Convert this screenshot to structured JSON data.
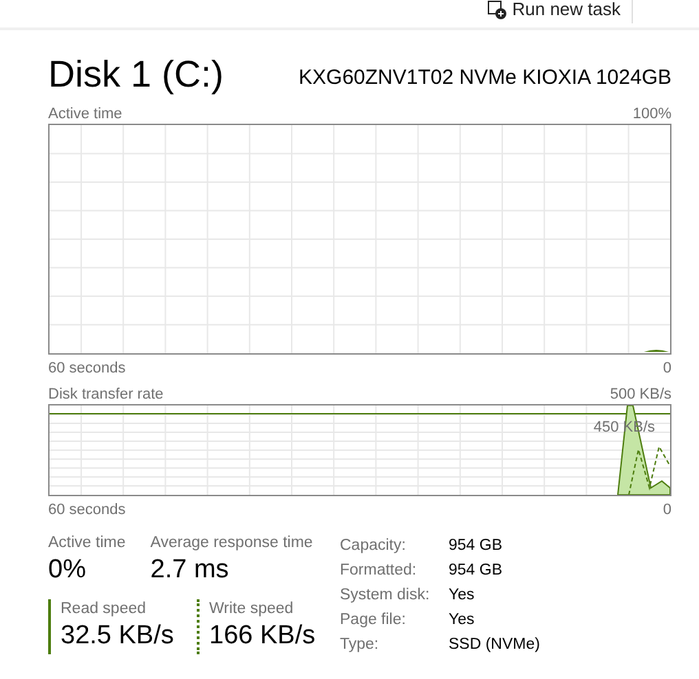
{
  "toolbar": {
    "run_new_task": "Run new task"
  },
  "header": {
    "title": "Disk 1 (C:)",
    "model": "KXG60ZNV1T02 NVMe KIOXIA 1024GB"
  },
  "active_time_graph": {
    "label": "Active time",
    "max": "100%",
    "x_span": "60 seconds",
    "min": "0"
  },
  "transfer_graph": {
    "label": "Disk transfer rate",
    "max": "500 KB/s",
    "line_label": "450 KB/s",
    "x_span": "60 seconds",
    "min": "0"
  },
  "stats": [
    {
      "label": "Active time",
      "value": "0%"
    },
    {
      "label": "Average response time",
      "value": "2.7 ms"
    }
  ],
  "speeds": [
    {
      "label": "Read speed",
      "value": "32.5 KB/s",
      "kind": "solid"
    },
    {
      "label": "Write speed",
      "value": "166 KB/s",
      "kind": "dashed"
    }
  ],
  "properties": [
    {
      "label": "Capacity:",
      "value": "954 GB"
    },
    {
      "label": "Formatted:",
      "value": "954 GB"
    },
    {
      "label": "System disk:",
      "value": "Yes"
    },
    {
      "label": "Page file:",
      "value": "Yes"
    },
    {
      "label": "Type:",
      "value": "SSD (NVMe)"
    }
  ]
}
